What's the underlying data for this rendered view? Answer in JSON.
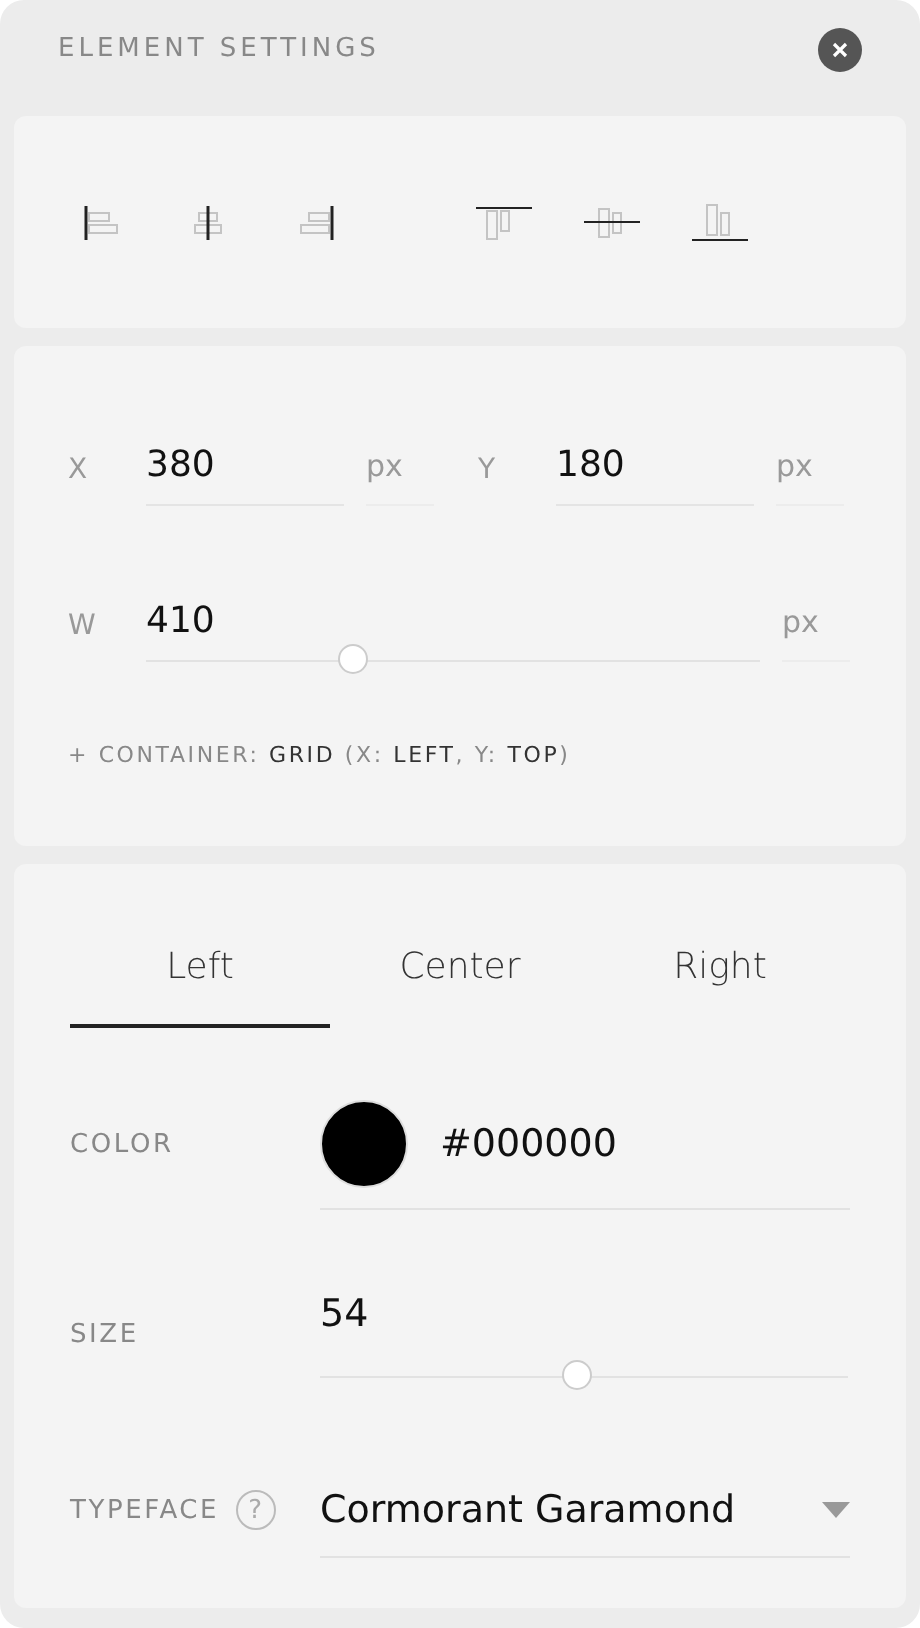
{
  "panel": {
    "title": "ELEMENT SETTINGS"
  },
  "align_buttons": [
    {
      "kind": "left"
    },
    {
      "kind": "hcenter"
    },
    {
      "kind": "right"
    },
    {
      "kind": "top"
    },
    {
      "kind": "vcenter"
    },
    {
      "kind": "bottom"
    }
  ],
  "position": {
    "x_label": "X",
    "x_value": "380",
    "x_unit": "px",
    "y_label": "Y",
    "y_value": "180",
    "y_unit": "px",
    "w_label": "W",
    "w_value": "410",
    "w_unit": "px"
  },
  "width_slider": {
    "level": 0.34
  },
  "container_note": "+ CONTAINER: **GRID** (X: **LEFT**, Y: **TOP**)",
  "tabs": [
    {
      "label": "Left",
      "selected": true
    },
    {
      "label": "Center",
      "selected": false
    },
    {
      "label": "Right",
      "selected": false
    }
  ],
  "color": {
    "label": "COLOR",
    "value": "#000000"
  },
  "size": {
    "label": "SIZE",
    "value": "54",
    "level": 0.49
  },
  "typeface": {
    "label": "TYPEFACE",
    "help": "?",
    "value": "Cormorant Garamond"
  }
}
